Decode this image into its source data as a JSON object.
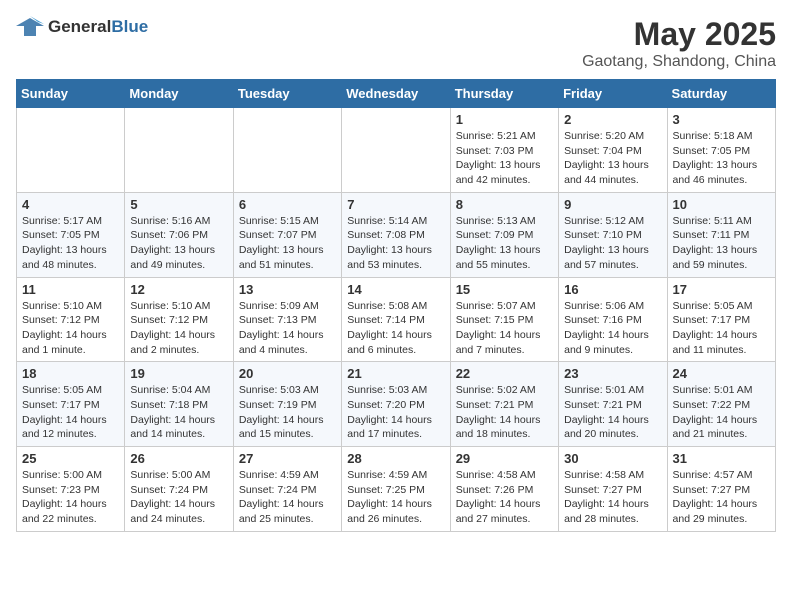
{
  "logo": {
    "general": "General",
    "blue": "Blue"
  },
  "title": "May 2025",
  "subtitle": "Gaotang, Shandong, China",
  "weekdays": [
    "Sunday",
    "Monday",
    "Tuesday",
    "Wednesday",
    "Thursday",
    "Friday",
    "Saturday"
  ],
  "weeks": [
    [
      {
        "day": "",
        "info": ""
      },
      {
        "day": "",
        "info": ""
      },
      {
        "day": "",
        "info": ""
      },
      {
        "day": "",
        "info": ""
      },
      {
        "day": "1",
        "info": "Sunrise: 5:21 AM\nSunset: 7:03 PM\nDaylight: 13 hours\nand 42 minutes."
      },
      {
        "day": "2",
        "info": "Sunrise: 5:20 AM\nSunset: 7:04 PM\nDaylight: 13 hours\nand 44 minutes."
      },
      {
        "day": "3",
        "info": "Sunrise: 5:18 AM\nSunset: 7:05 PM\nDaylight: 13 hours\nand 46 minutes."
      }
    ],
    [
      {
        "day": "4",
        "info": "Sunrise: 5:17 AM\nSunset: 7:05 PM\nDaylight: 13 hours\nand 48 minutes."
      },
      {
        "day": "5",
        "info": "Sunrise: 5:16 AM\nSunset: 7:06 PM\nDaylight: 13 hours\nand 49 minutes."
      },
      {
        "day": "6",
        "info": "Sunrise: 5:15 AM\nSunset: 7:07 PM\nDaylight: 13 hours\nand 51 minutes."
      },
      {
        "day": "7",
        "info": "Sunrise: 5:14 AM\nSunset: 7:08 PM\nDaylight: 13 hours\nand 53 minutes."
      },
      {
        "day": "8",
        "info": "Sunrise: 5:13 AM\nSunset: 7:09 PM\nDaylight: 13 hours\nand 55 minutes."
      },
      {
        "day": "9",
        "info": "Sunrise: 5:12 AM\nSunset: 7:10 PM\nDaylight: 13 hours\nand 57 minutes."
      },
      {
        "day": "10",
        "info": "Sunrise: 5:11 AM\nSunset: 7:11 PM\nDaylight: 13 hours\nand 59 minutes."
      }
    ],
    [
      {
        "day": "11",
        "info": "Sunrise: 5:10 AM\nSunset: 7:12 PM\nDaylight: 14 hours\nand 1 minute."
      },
      {
        "day": "12",
        "info": "Sunrise: 5:10 AM\nSunset: 7:12 PM\nDaylight: 14 hours\nand 2 minutes."
      },
      {
        "day": "13",
        "info": "Sunrise: 5:09 AM\nSunset: 7:13 PM\nDaylight: 14 hours\nand 4 minutes."
      },
      {
        "day": "14",
        "info": "Sunrise: 5:08 AM\nSunset: 7:14 PM\nDaylight: 14 hours\nand 6 minutes."
      },
      {
        "day": "15",
        "info": "Sunrise: 5:07 AM\nSunset: 7:15 PM\nDaylight: 14 hours\nand 7 minutes."
      },
      {
        "day": "16",
        "info": "Sunrise: 5:06 AM\nSunset: 7:16 PM\nDaylight: 14 hours\nand 9 minutes."
      },
      {
        "day": "17",
        "info": "Sunrise: 5:05 AM\nSunset: 7:17 PM\nDaylight: 14 hours\nand 11 minutes."
      }
    ],
    [
      {
        "day": "18",
        "info": "Sunrise: 5:05 AM\nSunset: 7:17 PM\nDaylight: 14 hours\nand 12 minutes."
      },
      {
        "day": "19",
        "info": "Sunrise: 5:04 AM\nSunset: 7:18 PM\nDaylight: 14 hours\nand 14 minutes."
      },
      {
        "day": "20",
        "info": "Sunrise: 5:03 AM\nSunset: 7:19 PM\nDaylight: 14 hours\nand 15 minutes."
      },
      {
        "day": "21",
        "info": "Sunrise: 5:03 AM\nSunset: 7:20 PM\nDaylight: 14 hours\nand 17 minutes."
      },
      {
        "day": "22",
        "info": "Sunrise: 5:02 AM\nSunset: 7:21 PM\nDaylight: 14 hours\nand 18 minutes."
      },
      {
        "day": "23",
        "info": "Sunrise: 5:01 AM\nSunset: 7:21 PM\nDaylight: 14 hours\nand 20 minutes."
      },
      {
        "day": "24",
        "info": "Sunrise: 5:01 AM\nSunset: 7:22 PM\nDaylight: 14 hours\nand 21 minutes."
      }
    ],
    [
      {
        "day": "25",
        "info": "Sunrise: 5:00 AM\nSunset: 7:23 PM\nDaylight: 14 hours\nand 22 minutes."
      },
      {
        "day": "26",
        "info": "Sunrise: 5:00 AM\nSunset: 7:24 PM\nDaylight: 14 hours\nand 24 minutes."
      },
      {
        "day": "27",
        "info": "Sunrise: 4:59 AM\nSunset: 7:24 PM\nDaylight: 14 hours\nand 25 minutes."
      },
      {
        "day": "28",
        "info": "Sunrise: 4:59 AM\nSunset: 7:25 PM\nDaylight: 14 hours\nand 26 minutes."
      },
      {
        "day": "29",
        "info": "Sunrise: 4:58 AM\nSunset: 7:26 PM\nDaylight: 14 hours\nand 27 minutes."
      },
      {
        "day": "30",
        "info": "Sunrise: 4:58 AM\nSunset: 7:27 PM\nDaylight: 14 hours\nand 28 minutes."
      },
      {
        "day": "31",
        "info": "Sunrise: 4:57 AM\nSunset: 7:27 PM\nDaylight: 14 hours\nand 29 minutes."
      }
    ]
  ]
}
